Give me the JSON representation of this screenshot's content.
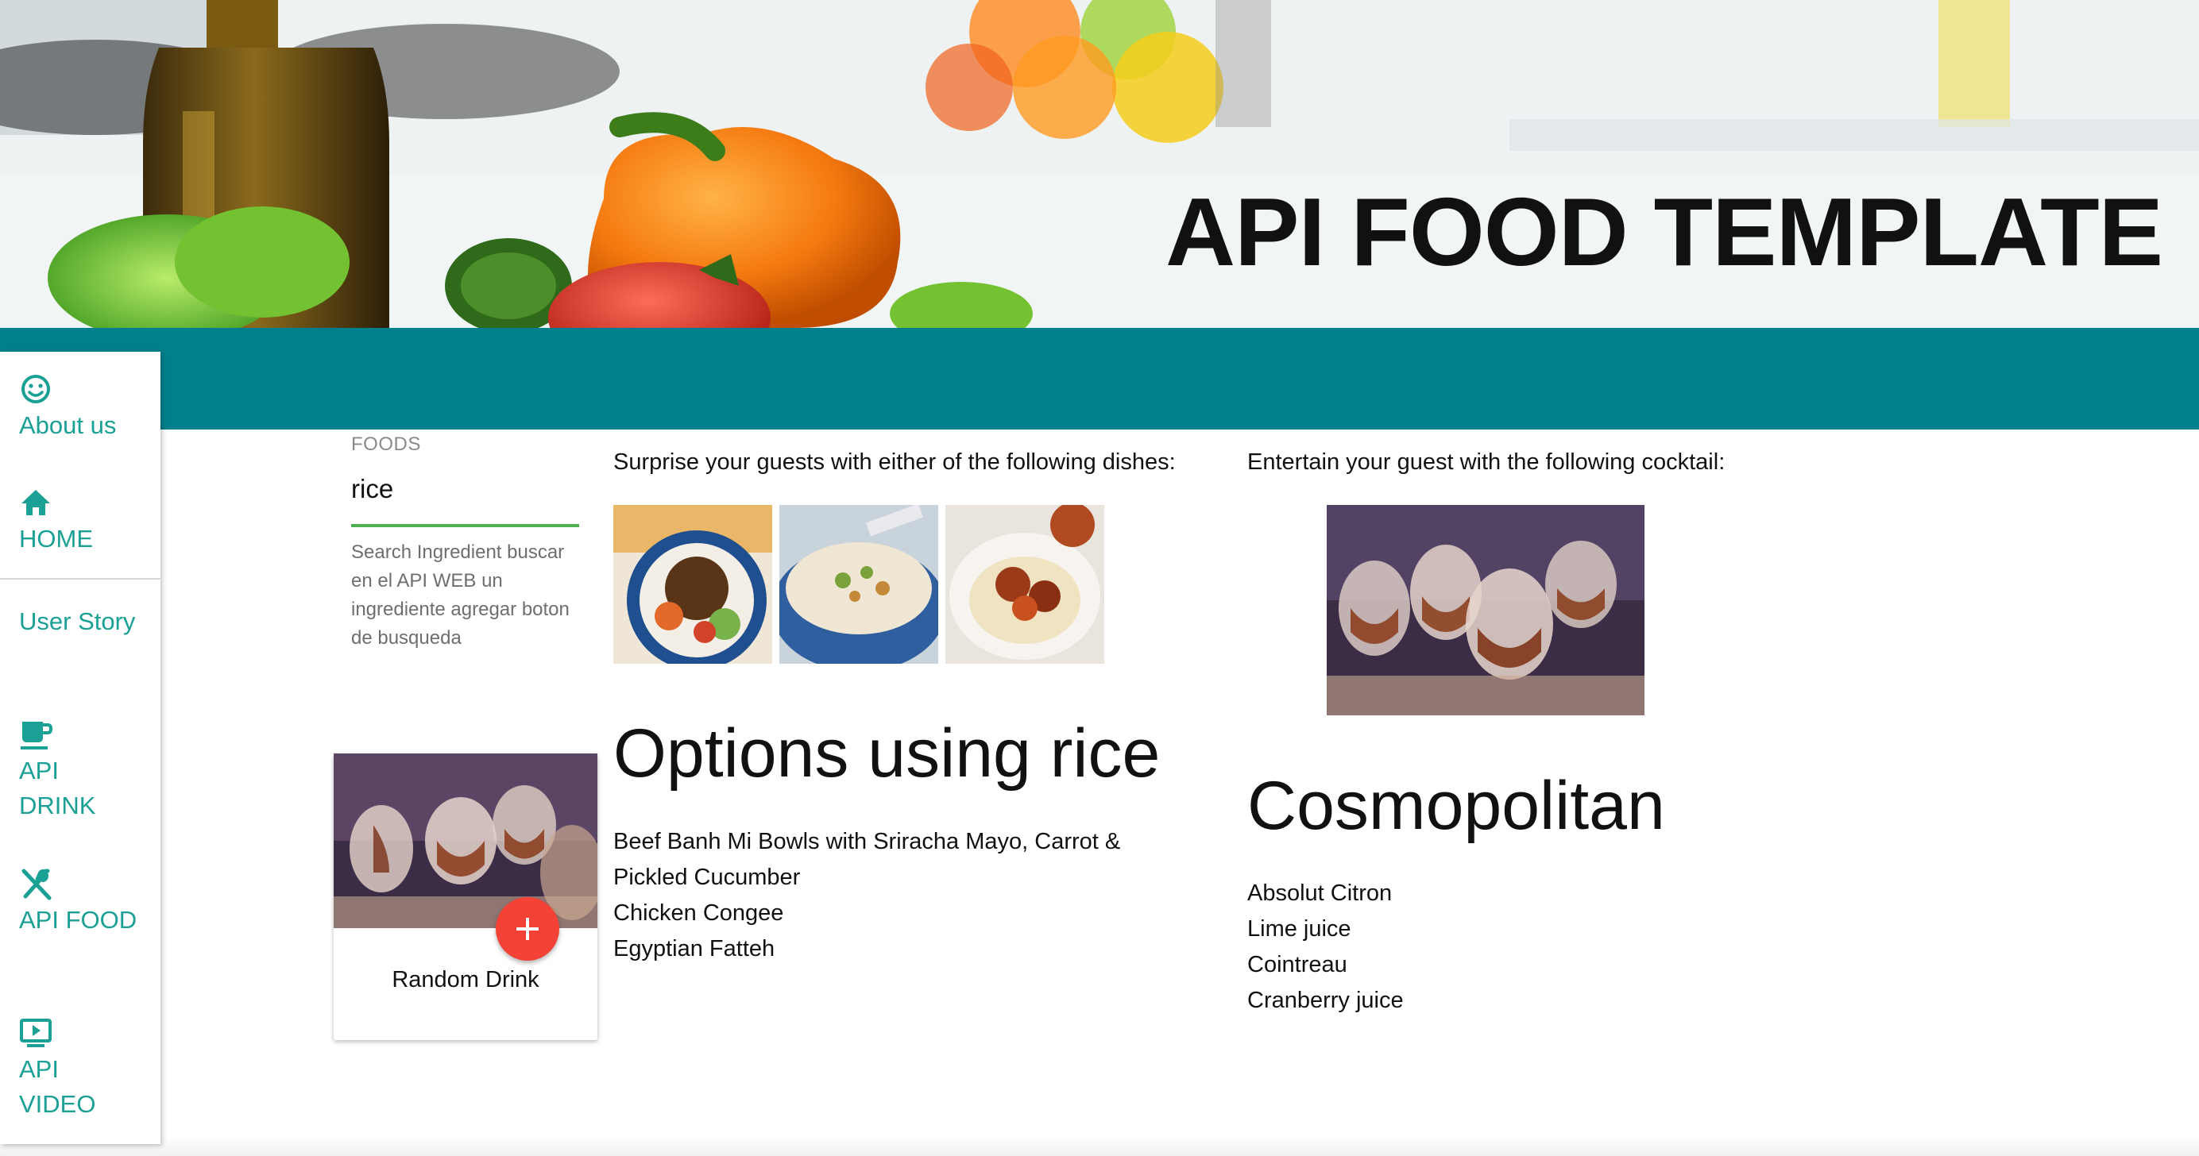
{
  "hero": {
    "title": "API FOOD TEMPLATE"
  },
  "sidebar": {
    "items": [
      {
        "label": "About us",
        "icon": "smiley-icon"
      },
      {
        "label": "HOME",
        "icon": "home-icon"
      },
      {
        "label": "User Story",
        "icon": ""
      },
      {
        "label": "API DRINK",
        "icon": "coffee-cup-icon"
      },
      {
        "label": "API FOOD",
        "icon": "fork-spoon-icon"
      },
      {
        "label": "API VIDEO",
        "icon": "tv-play-icon"
      }
    ]
  },
  "search": {
    "label": "FOODS",
    "value": "rice",
    "helper": "Search Ingredient buscar en el API WEB un ingrediente agregar boton de busqueda"
  },
  "random_card": {
    "title": "Random Drink",
    "fab_icon": "plus-icon"
  },
  "foods": {
    "intro": "Surprise your guests with either of the following dishes:",
    "heading": "Options using rice",
    "recipes": [
      "Beef Banh Mi Bowls with Sriracha Mayo, Carrot & Pickled Cucumber",
      "Chicken Congee",
      "Egyptian Fatteh"
    ]
  },
  "cocktail": {
    "intro": "Entertain your guest with the following cocktail:",
    "name": "Cosmopolitan",
    "ingredients": [
      "Absolut Citron",
      "Lime juice",
      "Cointreau",
      "Cranberry juice"
    ]
  },
  "colors": {
    "teal": "#00808c",
    "accent": "#1aa095",
    "fab": "#f44336",
    "underline": "#4caf50"
  }
}
